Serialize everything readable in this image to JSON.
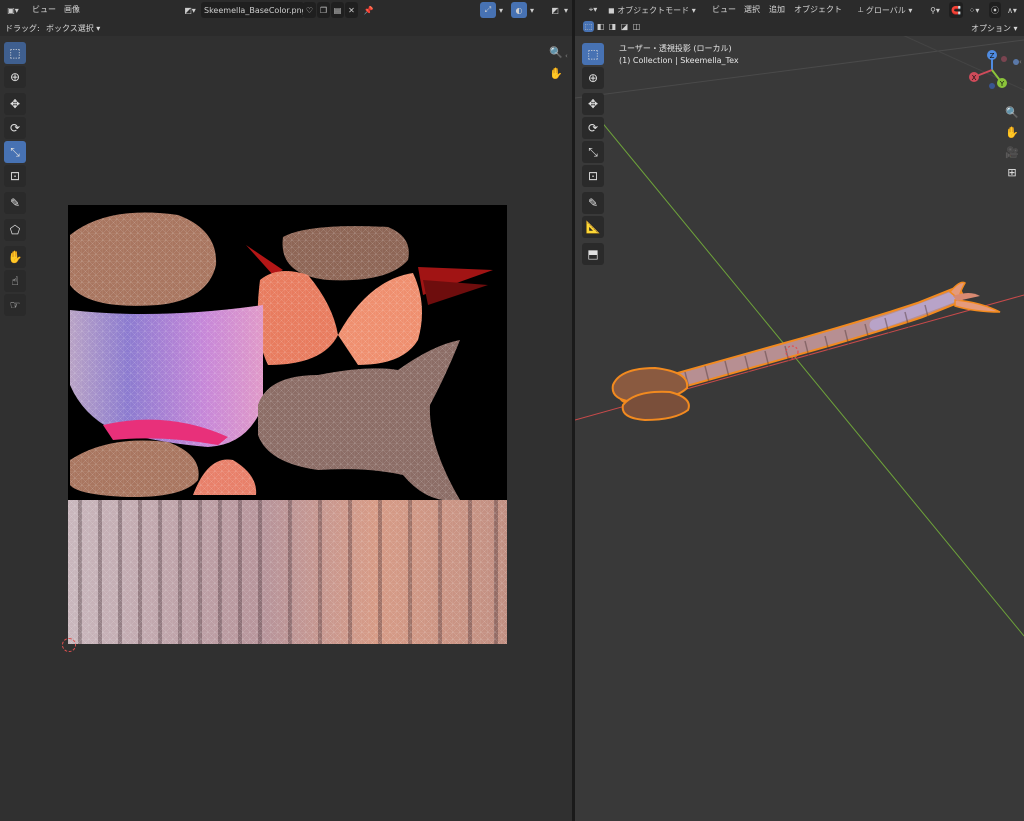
{
  "uv_editor": {
    "header": {
      "menus": [
        "ビュー",
        "画像"
      ],
      "image_name": "Skeemella_BaseColor.png"
    },
    "sub": {
      "drag_label": "ドラッグ:",
      "drag_value": "ボックス選択"
    },
    "tools": [
      "select-box",
      "cursor",
      "move",
      "rotate",
      "scale",
      "transform",
      "annotate",
      "annotate-polygon",
      "grab",
      "relax",
      "pinch"
    ]
  },
  "viewport": {
    "header": {
      "mode": "オブジェクトモード",
      "menus": [
        "ビュー",
        "選択",
        "追加",
        "オブジェクト"
      ],
      "orientation": "グローバル"
    },
    "sub": {
      "options": "オプション"
    },
    "overlay": {
      "view_name": "ユーザー・透視投影 (ローカル)",
      "collection": "(1) Collection | Skeemella_Tex"
    },
    "gizmo_axes": [
      "Z",
      "X",
      "Y"
    ],
    "colors": {
      "selection_outline": "#f28a1f",
      "x_axis": "#c84a4a",
      "y_axis": "#6ea33a",
      "active_tool": "#4772b3"
    }
  }
}
